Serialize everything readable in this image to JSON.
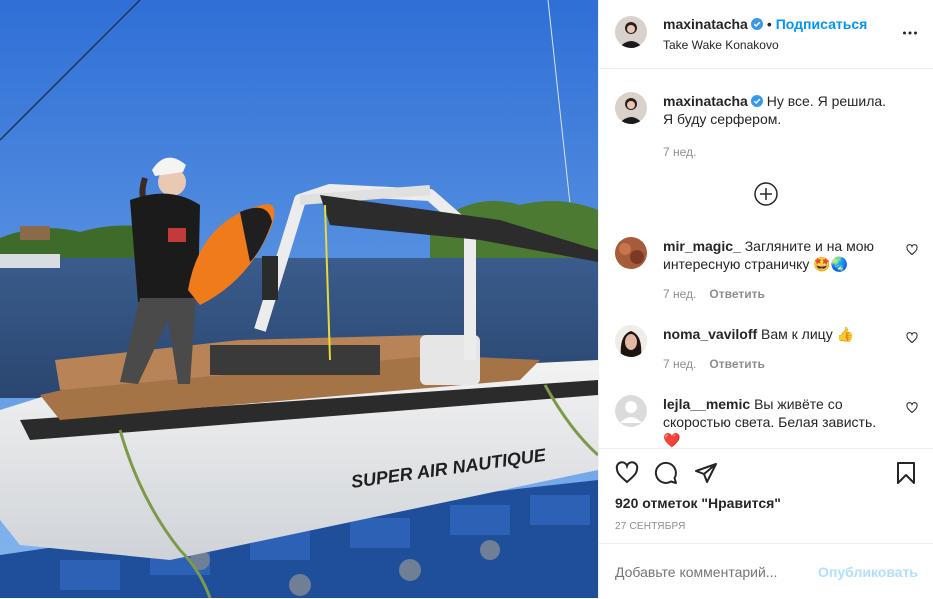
{
  "header": {
    "username": "maxinatacha",
    "dot": "•",
    "follow_label": "Подписаться",
    "location": "Take Wake Konakovo"
  },
  "caption": {
    "username": "maxinatacha",
    "text": "Ну все. Я решила. Я буду серфером.",
    "time": "7 нед."
  },
  "comments": [
    {
      "username": "mir_magic_",
      "text": "Загляните и на мою интересную страничку 🤩🌏",
      "time": "7 нед.",
      "reply": "Ответить"
    },
    {
      "username": "noma_vaviloff",
      "text": "Вам к лицу 👍",
      "time": "7 нед.",
      "reply": "Ответить"
    },
    {
      "username": "lejla__memic",
      "text": "Вы живёте со скоростью света. Белая зависть. ❤️",
      "time": "",
      "reply": ""
    }
  ],
  "photo": {
    "boat_brand": "SUPER AIR NAUTIQUE"
  },
  "footer": {
    "likes": "920 отметок \"Нравится\"",
    "date": "27 СЕНТЯБРЯ",
    "comment_placeholder": "Добавьте комментарий...",
    "publish_label": "Опубликовать"
  },
  "colors": {
    "link": "#0095f6",
    "publish_disabled": "#b2dffc",
    "verified": "#3897f0",
    "secondary": "#8e8e8e"
  }
}
